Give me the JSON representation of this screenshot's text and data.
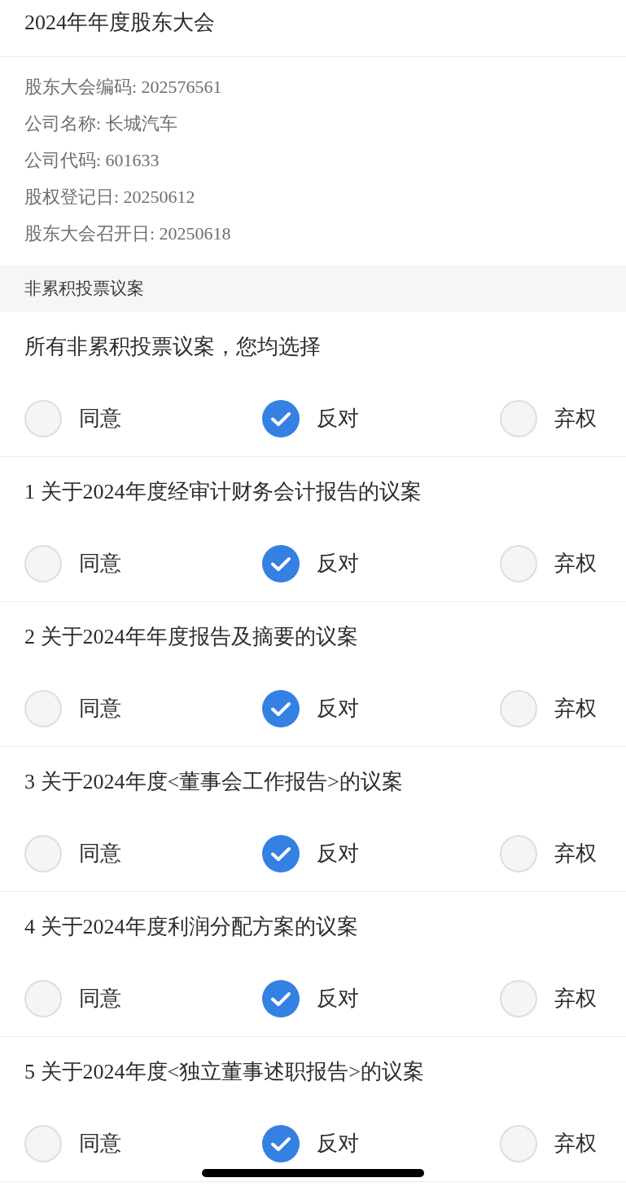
{
  "header": {
    "title": "2024年年度股东大会"
  },
  "info": [
    {
      "text": "股东大会编码: 202576561"
    },
    {
      "text": "公司名称: 长城汽车"
    },
    {
      "text": "公司代码: 601633"
    },
    {
      "text": "股权登记日: 20250612"
    },
    {
      "text": "股东大会召开日: 20250618"
    }
  ],
  "section": {
    "title": "非累积投票议案"
  },
  "proposals": [
    {
      "title": "所有非累积投票议案，您均选择",
      "options": [
        {
          "label": "同意",
          "selected": false
        },
        {
          "label": "反对",
          "selected": true
        },
        {
          "label": "弃权",
          "selected": false
        }
      ]
    },
    {
      "title": "1 关于2024年度经审计财务会计报告的议案",
      "options": [
        {
          "label": "同意",
          "selected": false
        },
        {
          "label": "反对",
          "selected": true
        },
        {
          "label": "弃权",
          "selected": false
        }
      ]
    },
    {
      "title": "2 关于2024年年度报告及摘要的议案",
      "options": [
        {
          "label": "同意",
          "selected": false
        },
        {
          "label": "反对",
          "selected": true
        },
        {
          "label": "弃权",
          "selected": false
        }
      ]
    },
    {
      "title": "3 关于2024年度<董事会工作报告>的议案",
      "options": [
        {
          "label": "同意",
          "selected": false
        },
        {
          "label": "反对",
          "selected": true
        },
        {
          "label": "弃权",
          "selected": false
        }
      ]
    },
    {
      "title": "4 关于2024年度利润分配方案的议案",
      "options": [
        {
          "label": "同意",
          "selected": false
        },
        {
          "label": "反对",
          "selected": true
        },
        {
          "label": "弃权",
          "selected": false
        }
      ]
    },
    {
      "title": "5 关于2024年度<独立董事述职报告>的议案",
      "options": [
        {
          "label": "同意",
          "selected": false
        },
        {
          "label": "反对",
          "selected": true
        },
        {
          "label": "弃权",
          "selected": false
        }
      ]
    }
  ]
}
